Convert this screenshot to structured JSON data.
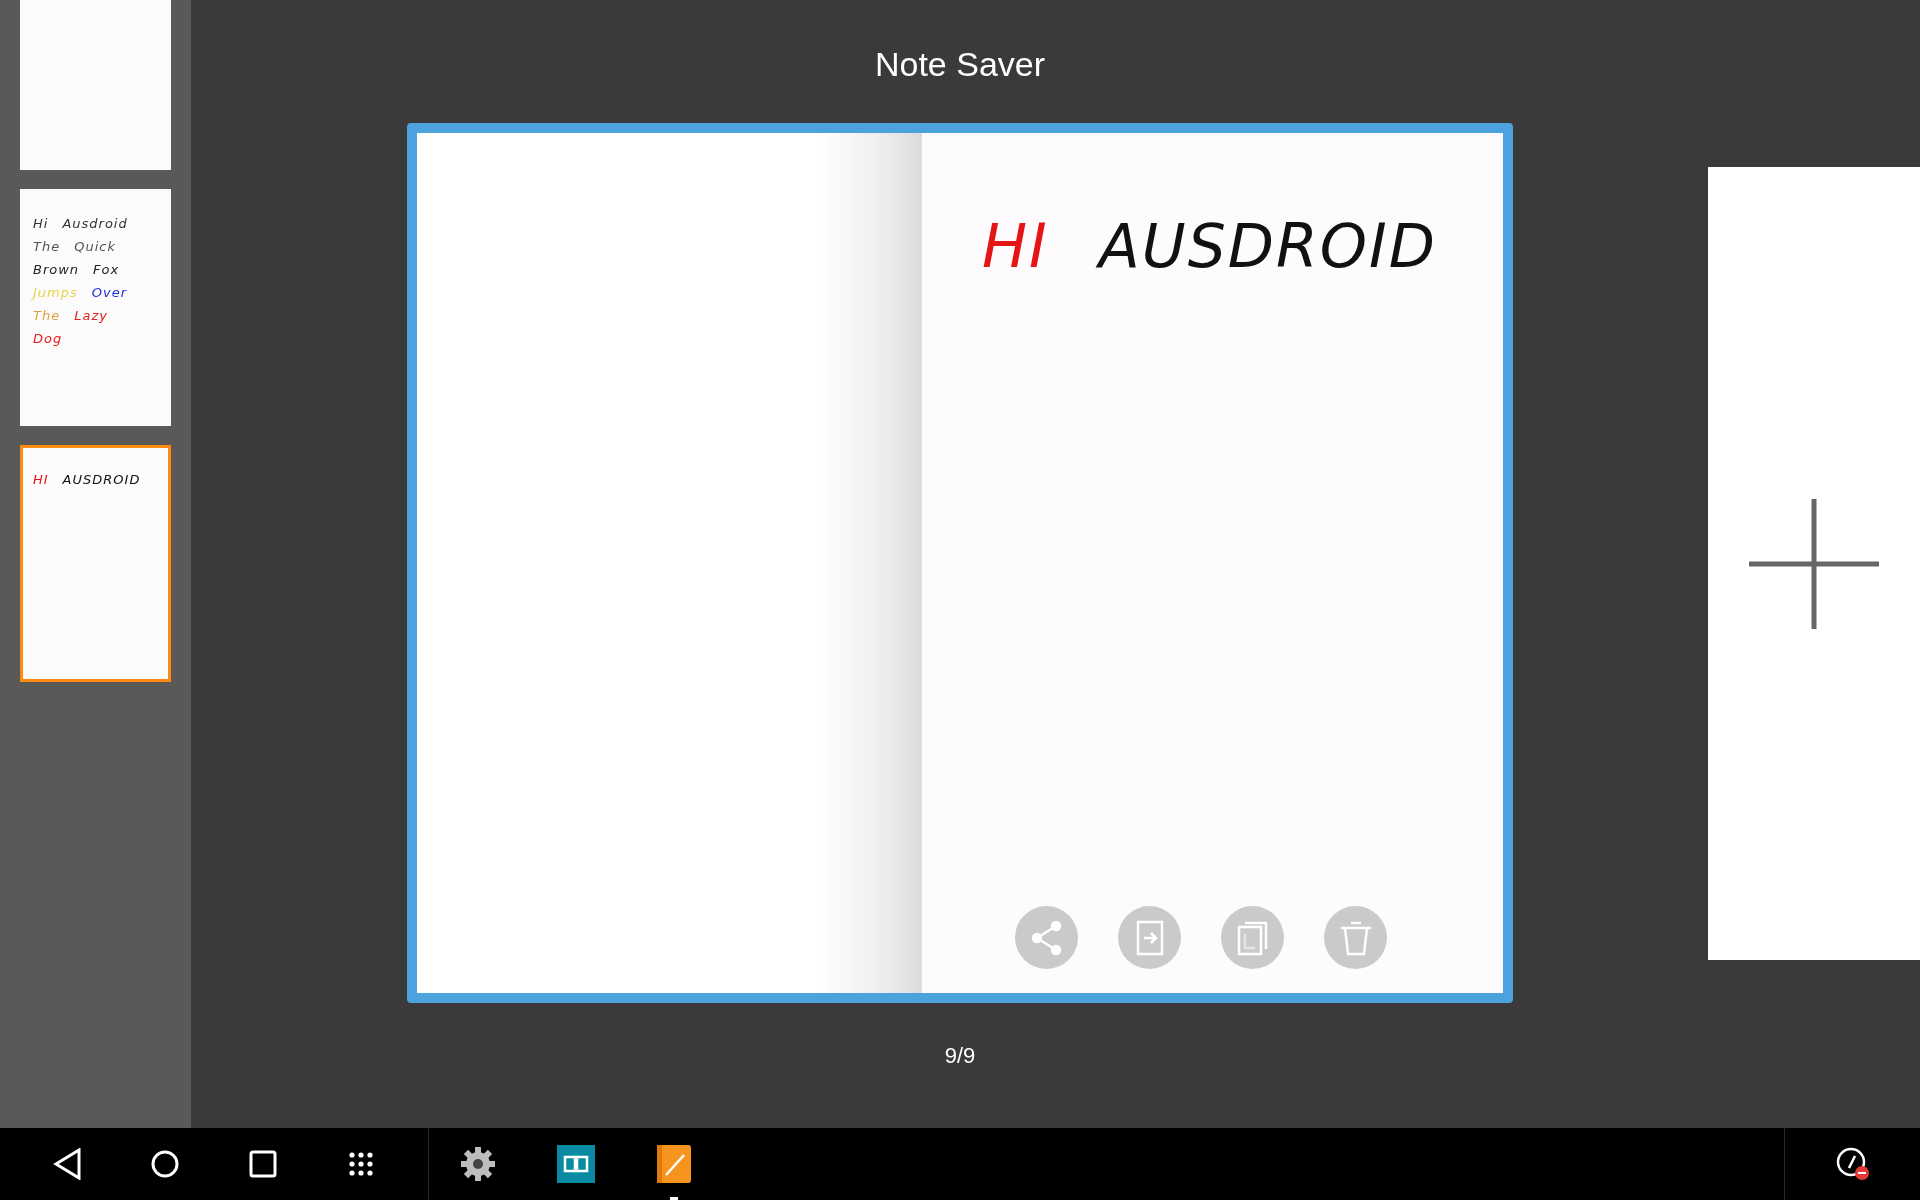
{
  "app": {
    "title": "Note Saver"
  },
  "thumbnails": [
    {
      "selected": false
    },
    {
      "selected": false,
      "lines": [
        [
          {
            "text": "Hi",
            "color": "#333333"
          },
          {
            "text": "Ausdroid",
            "color": "#333333"
          }
        ],
        [
          {
            "text": "The",
            "color": "#555555"
          },
          {
            "text": "Quick",
            "color": "#555555"
          }
        ],
        [
          {
            "text": "Brown",
            "color": "#222222"
          },
          {
            "text": "Fox",
            "color": "#222222"
          }
        ],
        [
          {
            "text": "Jumps",
            "color": "#e8d44a"
          },
          {
            "text": "Over",
            "color": "#2233dd"
          }
        ],
        [
          {
            "text": "The",
            "color": "#e0a040"
          },
          {
            "text": "Lazy",
            "color": "#e52020"
          }
        ],
        [
          {
            "text": "Dog",
            "color": "#e52020"
          }
        ]
      ]
    },
    {
      "selected": true,
      "lines": [
        [
          {
            "text": "HI",
            "color": "#e51515"
          },
          {
            "text": "AUSDROID",
            "color": "#111111"
          }
        ]
      ]
    }
  ],
  "note": {
    "words": [
      {
        "text": "HI",
        "color": "#e51515"
      },
      {
        "text": "AUSDROID",
        "color": "#111111"
      }
    ],
    "actions": [
      {
        "kind": "share"
      },
      {
        "kind": "export"
      },
      {
        "kind": "copy"
      },
      {
        "kind": "delete"
      }
    ]
  },
  "page_counter": "9/9",
  "taskbar": {
    "nav": [
      {
        "kind": "back"
      },
      {
        "kind": "home"
      },
      {
        "kind": "recents"
      },
      {
        "kind": "apps"
      }
    ],
    "apps": [
      {
        "kind": "settings",
        "selected": false
      },
      {
        "kind": "reader",
        "selected": false
      },
      {
        "kind": "notes",
        "selected": true
      }
    ]
  }
}
